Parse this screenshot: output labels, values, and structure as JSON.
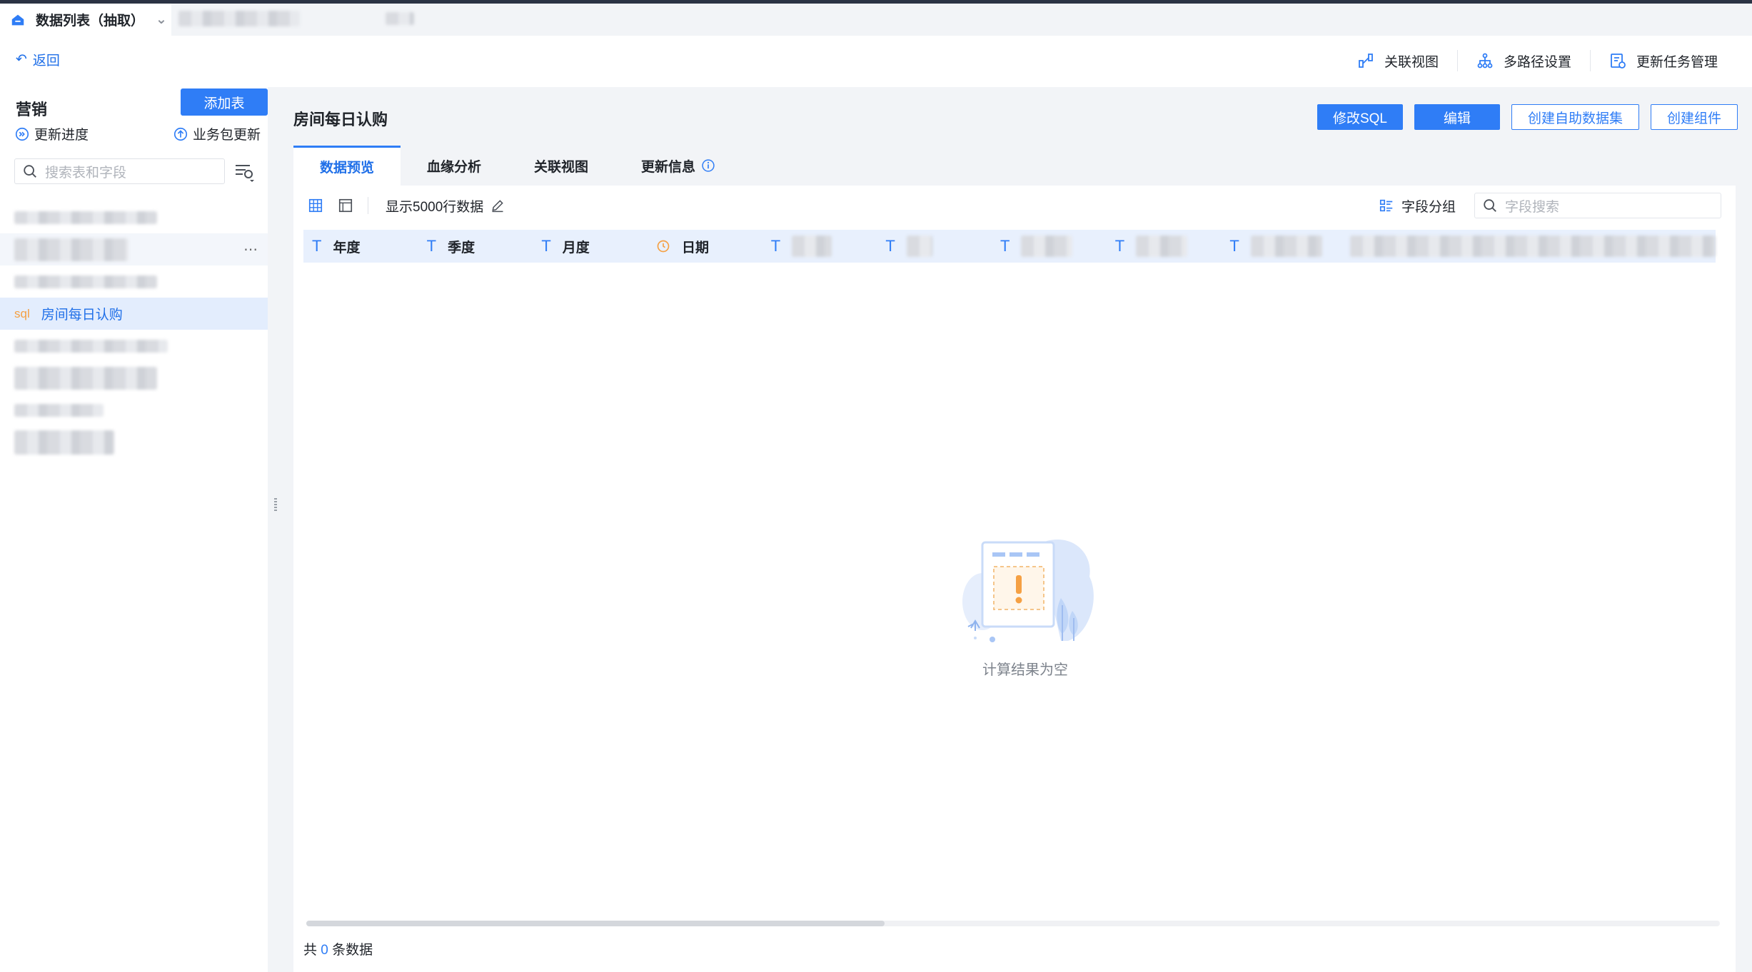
{
  "datasource_tab": {
    "title": "数据列表（抽取）"
  },
  "toolbar": {
    "back_label": "返回",
    "items": [
      {
        "label": "关联视图",
        "icon": "relation-view-icon"
      },
      {
        "label": "多路径设置",
        "icon": "multipath-icon"
      },
      {
        "label": "更新任务管理",
        "icon": "task-manage-icon"
      }
    ]
  },
  "sidebar": {
    "title": "营销",
    "add_button": "添加表",
    "update_progress": "更新进度",
    "package_update": "业务包更新",
    "search_placeholder": "搜索表和字段",
    "active_item": {
      "badge": "sql",
      "label": "房间每日认购"
    }
  },
  "main": {
    "title": "房间每日认购",
    "buttons": {
      "modify_sql": "修改SQL",
      "edit": "编辑",
      "create_dataset": "创建自助数据集",
      "create_component": "创建组件"
    },
    "tabs": [
      "数据预览",
      "血缘分析",
      "关联视图",
      "更新信息"
    ],
    "preview": {
      "rows_label": "显示5000行数据",
      "group_label": "字段分组",
      "field_search_placeholder": "字段搜索"
    },
    "columns": [
      {
        "type": "T",
        "label": "年度"
      },
      {
        "type": "T",
        "label": "季度"
      },
      {
        "type": "T",
        "label": "月度"
      },
      {
        "type": "date",
        "label": "日期"
      }
    ],
    "empty_text": "计算结果为空",
    "footer": {
      "prefix": "共",
      "count": "0",
      "suffix": "条数据"
    }
  },
  "colors": {
    "accent": "#2f7df6",
    "active_bg": "#e3edfd",
    "sql_badge": "#f5a043"
  }
}
